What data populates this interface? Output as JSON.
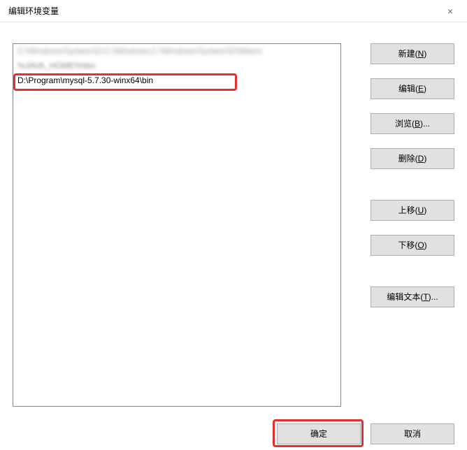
{
  "title": "编辑环境变量",
  "close_label": "×",
  "list": {
    "items": [
      {
        "text": "C:\\Windows\\System32;C:\\Windows;C:\\Windows\\System32\\Wbem",
        "blurred": true
      },
      {
        "text": "%JAVA_HOME%\\bin",
        "partial": true
      },
      {
        "text": "D:\\Program\\mysql-5.7.30-winx64\\bin",
        "blurred": false
      }
    ]
  },
  "buttons": {
    "new": {
      "label": "新建(",
      "accel": "N",
      "suffix": ")"
    },
    "edit": {
      "label": "编辑(",
      "accel": "E",
      "suffix": ")"
    },
    "browse": {
      "label": "浏览(",
      "accel": "B",
      "suffix": ")..."
    },
    "delete": {
      "label": "删除(",
      "accel": "D",
      "suffix": ")"
    },
    "moveup": {
      "label": "上移(",
      "accel": "U",
      "suffix": ")"
    },
    "movedown": {
      "label": "下移(",
      "accel": "O",
      "suffix": ")"
    },
    "edittext": {
      "label": "编辑文本(",
      "accel": "T",
      "suffix": ")..."
    }
  },
  "footer": {
    "ok": "确定",
    "cancel": "取消"
  }
}
